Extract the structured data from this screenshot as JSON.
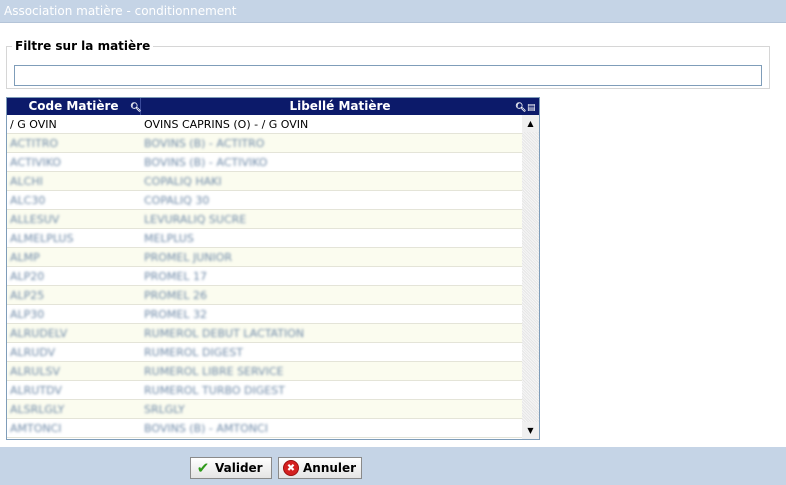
{
  "window": {
    "title": "Association matière - conditionnement"
  },
  "filter": {
    "legend": "Filtre sur la matière",
    "value": ""
  },
  "grid": {
    "columns": {
      "code": "Code Matière",
      "label": "Libellé Matière"
    },
    "rows": [
      {
        "code": "/ G OVIN",
        "label": "OVINS CAPRINS (O) - / G OVIN",
        "obscured": false
      },
      {
        "code": "ACTITRO",
        "label": "BOVINS (B) - ACTITRO",
        "obscured": true
      },
      {
        "code": "ACTIVIKO",
        "label": "BOVINS (B) - ACTIVIKO",
        "obscured": true
      },
      {
        "code": "ALCHI",
        "label": "COPALIQ HAKI",
        "obscured": true
      },
      {
        "code": "ALC30",
        "label": "COPALIQ 30",
        "obscured": true
      },
      {
        "code": "ALLESUV",
        "label": "LEVURALIQ SUCRE",
        "obscured": true
      },
      {
        "code": "ALMELPLUS",
        "label": "MELPLUS",
        "obscured": true
      },
      {
        "code": "ALMP",
        "label": "PROMEL JUNIOR",
        "obscured": true
      },
      {
        "code": "ALP20",
        "label": "PROMEL 17",
        "obscured": true
      },
      {
        "code": "ALP25",
        "label": "PROMEL 26",
        "obscured": true
      },
      {
        "code": "ALP30",
        "label": "PROMEL 32",
        "obscured": true
      },
      {
        "code": "ALRUDELV",
        "label": "RUMEROL DEBUT LACTATION",
        "obscured": true
      },
      {
        "code": "ALRUDV",
        "label": "RUMEROL DIGEST",
        "obscured": true
      },
      {
        "code": "ALRULSV",
        "label": "RUMEROL LIBRE SERVICE",
        "obscured": true
      },
      {
        "code": "ALRUTDV",
        "label": "RUMEROL TURBO DIGEST",
        "obscured": true
      },
      {
        "code": "ALSRLGLY",
        "label": "SRLGLY",
        "obscured": true
      },
      {
        "code": "AMTONCI",
        "label": "BOVINS (B) - AMTONCI",
        "obscured": true
      }
    ]
  },
  "buttons": {
    "ok": "Valider",
    "cancel": "Annuler"
  },
  "icons": {
    "ok": "check-icon",
    "cancel": "cancel-circle-icon",
    "header_search": "magnifier-icon",
    "header_sort": "sort-icon",
    "scroll_up": "arrow-up-icon",
    "scroll_down": "arrow-down-icon"
  },
  "colors": {
    "header_bg": "#0c1a6a",
    "frame_bg": "#c5d4e6",
    "row_alt": "#fbfcef"
  }
}
